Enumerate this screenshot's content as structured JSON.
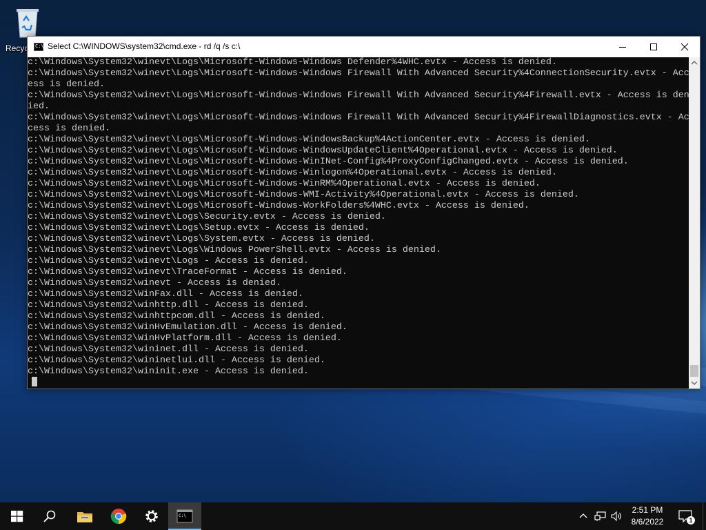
{
  "desktop": {
    "recycle_bin_label": "Recycle Bin"
  },
  "window": {
    "title": "Select C:\\WINDOWS\\system32\\cmd.exe - rd  /q /s c:\\",
    "icon_text": "C:\\"
  },
  "console": {
    "lines": [
      "c:\\Windows\\System32\\winevt\\Logs\\Microsoft-Windows-Windows Defender%4WHC.evtx - Access is denied.",
      "c:\\Windows\\System32\\winevt\\Logs\\Microsoft-Windows-Windows Firewall With Advanced Security%4ConnectionSecurity.evtx - Acc",
      "ess is denied.",
      "c:\\Windows\\System32\\winevt\\Logs\\Microsoft-Windows-Windows Firewall With Advanced Security%4Firewall.evtx - Access is den",
      "ied.",
      "c:\\Windows\\System32\\winevt\\Logs\\Microsoft-Windows-Windows Firewall With Advanced Security%4FirewallDiagnostics.evtx - Ac",
      "cess is denied.",
      "c:\\Windows\\System32\\winevt\\Logs\\Microsoft-Windows-WindowsBackup%4ActionCenter.evtx - Access is denied.",
      "c:\\Windows\\System32\\winevt\\Logs\\Microsoft-Windows-WindowsUpdateClient%4Operational.evtx - Access is denied.",
      "c:\\Windows\\System32\\winevt\\Logs\\Microsoft-Windows-WinINet-Config%4ProxyConfigChanged.evtx - Access is denied.",
      "c:\\Windows\\System32\\winevt\\Logs\\Microsoft-Windows-Winlogon%4Operational.evtx - Access is denied.",
      "c:\\Windows\\System32\\winevt\\Logs\\Microsoft-Windows-WinRM%4Operational.evtx - Access is denied.",
      "c:\\Windows\\System32\\winevt\\Logs\\Microsoft-Windows-WMI-Activity%4Operational.evtx - Access is denied.",
      "c:\\Windows\\System32\\winevt\\Logs\\Microsoft-Windows-WorkFolders%4WHC.evtx - Access is denied.",
      "c:\\Windows\\System32\\winevt\\Logs\\Security.evtx - Access is denied.",
      "c:\\Windows\\System32\\winevt\\Logs\\Setup.evtx - Access is denied.",
      "c:\\Windows\\System32\\winevt\\Logs\\System.evtx - Access is denied.",
      "c:\\Windows\\System32\\winevt\\Logs\\Windows PowerShell.evtx - Access is denied.",
      "c:\\Windows\\System32\\winevt\\Logs - Access is denied.",
      "c:\\Windows\\System32\\winevt\\TraceFormat - Access is denied.",
      "c:\\Windows\\System32\\winevt - Access is denied.",
      "c:\\Windows\\System32\\WinFax.dll - Access is denied.",
      "c:\\Windows\\System32\\winhttp.dll - Access is denied.",
      "c:\\Windows\\System32\\winhttpcom.dll - Access is denied.",
      "c:\\Windows\\System32\\WinHvEmulation.dll - Access is denied.",
      "c:\\Windows\\System32\\WinHvPlatform.dll - Access is denied.",
      "c:\\Windows\\System32\\wininet.dll - Access is denied.",
      "c:\\Windows\\System32\\wininetlui.dll - Access is denied.",
      "c:\\Windows\\System32\\wininit.exe - Access is denied."
    ]
  },
  "taskbar": {
    "pinned": [
      "start-icon",
      "search-icon",
      "file-explorer-icon",
      "chrome-icon",
      "settings-icon",
      "cmd-icon"
    ],
    "cmd_icon_text": "C:\\",
    "clock_time": "2:51 PM",
    "clock_date": "8/6/2022",
    "notification_count": "1"
  },
  "colors": {
    "console_bg": "#0c0c0c",
    "console_fg": "#cccccc",
    "taskbar_bg": "#101010",
    "active_accent": "#76b9ed"
  }
}
